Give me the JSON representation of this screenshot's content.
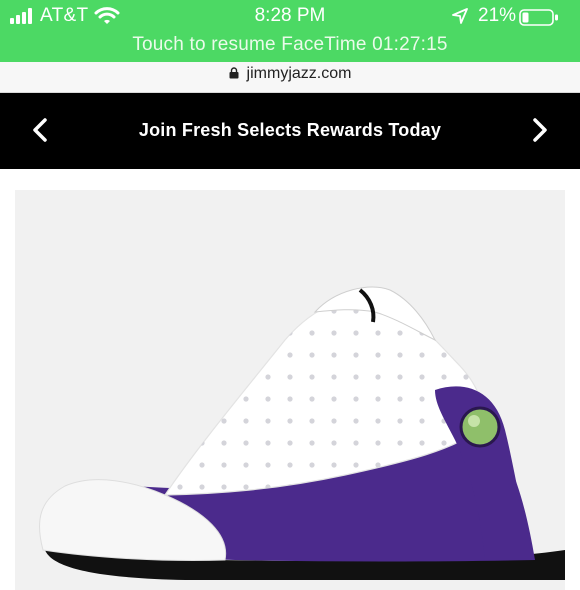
{
  "status_bar": {
    "carrier": "AT&T",
    "time": "8:28 PM",
    "battery_percent": "21%",
    "facetime_banner": "Touch to resume FaceTime 01:27:15",
    "icons": [
      "signal-icon",
      "wifi-icon",
      "location-arrow-icon",
      "battery-icon"
    ]
  },
  "browser": {
    "url": "jimmyjazz.com",
    "lock_icon": "lock-icon"
  },
  "promo_banner": {
    "text": "Join Fresh Selects Rewards Today",
    "prev_icon": "chevron-left-icon",
    "next_icon": "chevron-right-icon"
  },
  "product": {
    "image": "product-image",
    "colors": {
      "upper": "#ffffff",
      "accent": "#4b2a8c",
      "sole": "#111111",
      "window": "#8fbf6a"
    }
  },
  "colors": {
    "status_bar": "#4cd964",
    "promo_background": "#000000",
    "image_background": "#f1f1f1"
  }
}
